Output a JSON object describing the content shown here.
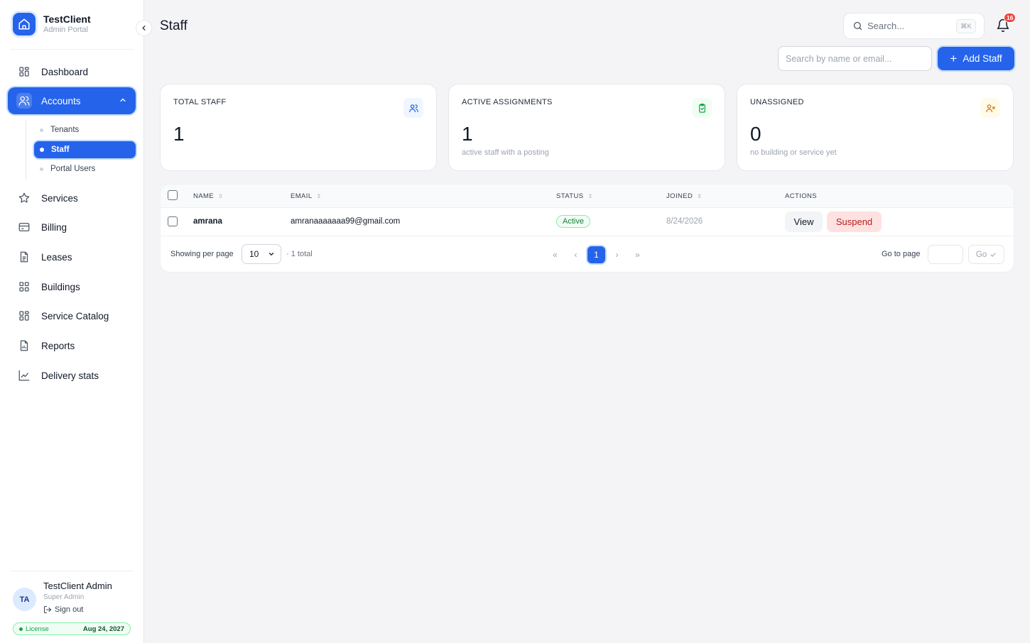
{
  "brand": {
    "name": "TestClient",
    "subtitle": "Admin Portal"
  },
  "sidebar": {
    "items": [
      {
        "label": "Dashboard",
        "icon": "grid-icon"
      },
      {
        "label": "Accounts",
        "icon": "users-icon",
        "active": true,
        "expanded": true
      },
      {
        "label": "Services",
        "icon": "star-icon"
      },
      {
        "label": "Billing",
        "icon": "credit-card-icon"
      },
      {
        "label": "Leases",
        "icon": "document-icon"
      },
      {
        "label": "Buildings",
        "icon": "grid-icon"
      },
      {
        "label": "Service Catalog",
        "icon": "grid-icon"
      },
      {
        "label": "Reports",
        "icon": "report-icon"
      },
      {
        "label": "Delivery stats",
        "icon": "line-chart-icon"
      }
    ],
    "subitems": [
      {
        "label": "Tenants"
      },
      {
        "label": "Staff",
        "active": true
      },
      {
        "label": "Portal Users"
      }
    ]
  },
  "user": {
    "initials": "TA",
    "name": "TestClient Admin",
    "role": "Super Admin",
    "signout": "Sign out",
    "license_label": "License",
    "license_date": "Aug 24, 2027"
  },
  "header": {
    "title": "Staff",
    "search_placeholder": "Search...",
    "search_shortcut": "⌘K",
    "notification_count": "16"
  },
  "toolbar": {
    "filter_placeholder": "Search by name or email...",
    "add_label": "Add Staff"
  },
  "stats": [
    {
      "label": "TOTAL STAFF",
      "value": "1",
      "sub": "",
      "icon": "users-icon",
      "accent": "#2563eb",
      "bg": "#eff6ff"
    },
    {
      "label": "ACTIVE ASSIGNMENTS",
      "value": "1",
      "sub": "active staff with a posting",
      "icon": "clipboard-check-icon",
      "accent": "#16a34a",
      "bg": "#f0fdf4"
    },
    {
      "label": "UNASSIGNED",
      "value": "0",
      "sub": "no building or service yet",
      "icon": "user-x-icon",
      "accent": "#d97706",
      "bg": "#fffbeb"
    }
  ],
  "table": {
    "columns": [
      "NAME",
      "EMAIL",
      "STATUS",
      "JOINED",
      "ACTIONS"
    ],
    "rows": [
      {
        "name": "amrana",
        "email": "amranaaaaaaa99@gmail.com",
        "status": "Active",
        "joined": "8/24/2026",
        "view": "View",
        "suspend": "Suspend"
      }
    ]
  },
  "pagination": {
    "per_page_label": "Showing per page",
    "per_page_value": "10",
    "total": "· 1 total",
    "current_page": "1",
    "goto_label": "Go to page",
    "go_label": "Go"
  },
  "colors": {
    "accent": "#2563eb",
    "success": "#16a34a",
    "danger": "#b91c1c",
    "badge": "#ef4444"
  }
}
